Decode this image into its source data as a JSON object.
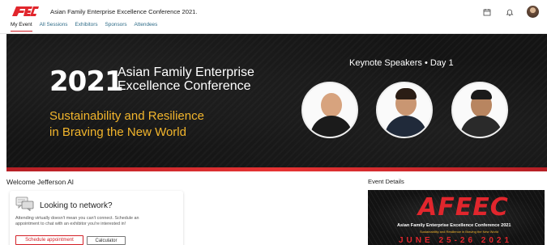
{
  "app": {
    "logo_text": "AFEEC",
    "title": "Asian Family Enterprise Excellence Conference 2021.",
    "header_icons": [
      "calendar-icon",
      "bell-icon",
      "user-avatar"
    ]
  },
  "nav": {
    "tabs": [
      {
        "label": "My Event",
        "active": true
      },
      {
        "label": "All Sessions",
        "active": false
      },
      {
        "label": "Exhibitors",
        "active": false
      },
      {
        "label": "Sponsors",
        "active": false
      },
      {
        "label": "Attendees",
        "active": false
      }
    ]
  },
  "banner": {
    "year": "2021",
    "name_line1": "Asian Family Enterprise",
    "name_line2": "Excellence Conference",
    "tagline_line1": "Sustainability and Resilience",
    "tagline_line2": "in Braving the New World",
    "keynote": "Keynote Speakers • Day 1",
    "colors": {
      "accent_gold": "#f2b52c",
      "brand_red": "#d32027"
    }
  },
  "welcome": {
    "heading": "Welcome Jefferson Al",
    "card": {
      "icon": "chat-bubbles-icon",
      "title": "Looking to network?",
      "text_line1": "Attending virtually doesn't mean you can't connect. Schedule an",
      "text_line2": "appointment to chat with an exhibitor you're interested in!",
      "primary_button": "Schedule appointment",
      "secondary_button": "Calculator"
    }
  },
  "event_details": {
    "heading": "Event Details",
    "image": {
      "logo": "AFEEC",
      "name": "Asian Family Enterprise Excellence Conference 2021",
      "tagline": "Sustainability and Resilience in Braving the New World",
      "date": "JUNE 25-26 2021"
    }
  }
}
